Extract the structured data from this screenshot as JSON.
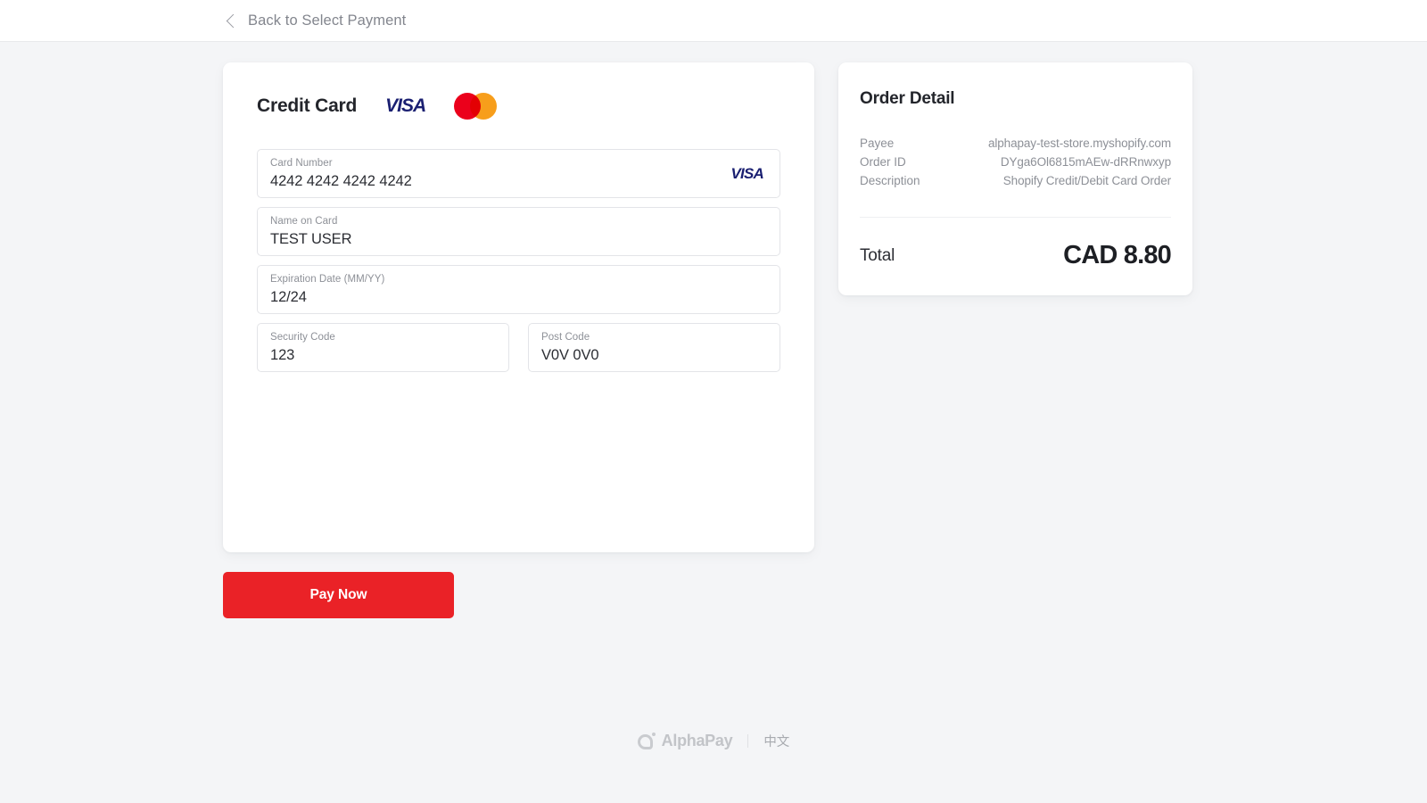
{
  "header": {
    "back_label": "Back to Select Payment",
    "back_icon": "chevron-left-icon"
  },
  "payment": {
    "title": "Credit Card",
    "brands": [
      {
        "name": "visa-logo",
        "label": "VISA"
      },
      {
        "name": "mastercard-logo",
        "label": ""
      }
    ],
    "fields": [
      {
        "label": "Card Number",
        "value": "4242 4242 4242 4242",
        "placeholder": "Card Number",
        "brand": "VISA"
      },
      {
        "label": "Name on Card",
        "value": "TEST USER",
        "placeholder": "Name on Card"
      },
      {
        "label": "Expiration Date (MM/YY)",
        "value": "12/24",
        "placeholder": "MM/YY"
      },
      {
        "label": "Security Code",
        "value": "123",
        "placeholder": "Security Code"
      },
      {
        "label": "Post Code",
        "value": "V0V 0V0",
        "placeholder": "Post Code"
      }
    ],
    "pay_button": "Pay Now"
  },
  "order": {
    "title": "Order Detail",
    "rows": [
      {
        "label": "Payee",
        "value": "alphapay-test-store.myshopify.com"
      },
      {
        "label": "Order ID",
        "value": "DYga6Ol6815mAEw-dRRnwxyp"
      },
      {
        "label": "Description",
        "value": "Shopify Credit/Debit Card Order"
      }
    ],
    "total_label": "Total",
    "total_amount": "CAD 8.80"
  },
  "footer": {
    "brand": "AlphaPay",
    "brand_icon": "alphapay-logo-icon",
    "language_link": "中文"
  },
  "colors": {
    "page_background": "#f4f5f7",
    "card_background": "#ffffff",
    "accent_pay": "#ea2227",
    "visa_blue": "#1a1f71",
    "mastercard_red": "#eb001b",
    "mastercard_amber": "#f79e1b",
    "muted_text": "#8d9097",
    "primary_text": "#23252b"
  }
}
